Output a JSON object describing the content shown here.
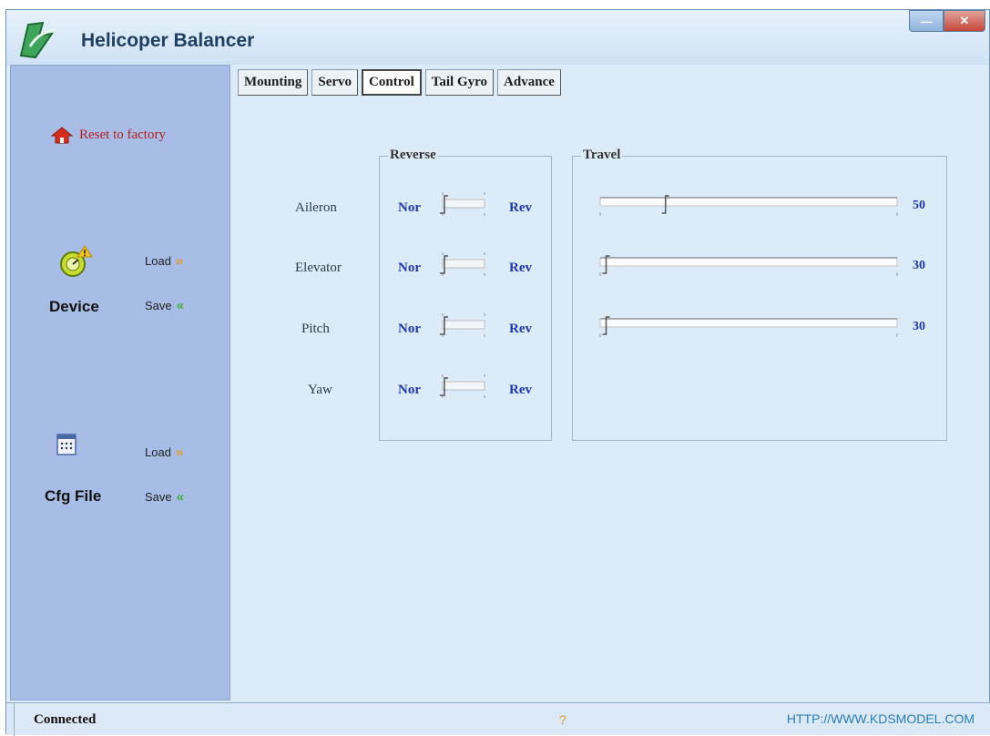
{
  "window": {
    "title": "Helicoper Balancer"
  },
  "sidebar": {
    "reset_label": "Reset to factory",
    "device": {
      "title": "Device",
      "load": "Load",
      "save": "Save"
    },
    "cfg": {
      "title": "Cfg File",
      "load": "Load",
      "save": "Save"
    }
  },
  "tabs": [
    "Mounting",
    "Servo",
    "Control",
    "Tail Gyro",
    "Advance"
  ],
  "active_tab": "Control",
  "reverse": {
    "legend": "Reverse",
    "off_label": "Nor",
    "on_label": "Rev",
    "channels": [
      {
        "name": "Aileron",
        "state": "Nor"
      },
      {
        "name": "Elevator",
        "state": "Nor"
      },
      {
        "name": "Pitch",
        "state": "Nor"
      },
      {
        "name": "Yaw",
        "state": "Nor"
      }
    ]
  },
  "travel": {
    "legend": "Travel",
    "values": [
      "50",
      "30",
      "30"
    ],
    "slider_fraction": [
      0.22,
      0.02,
      0.02
    ]
  },
  "status": {
    "connection": "Connected",
    "help": "?",
    "url": "HTTP://WWW.KDSMODEL.COM"
  },
  "colors": {
    "window_bg": "#dcebf8",
    "sidebar_bg": "#a8bde6",
    "value_blue": "#2137b2",
    "reset_red": "#b41e1e"
  }
}
